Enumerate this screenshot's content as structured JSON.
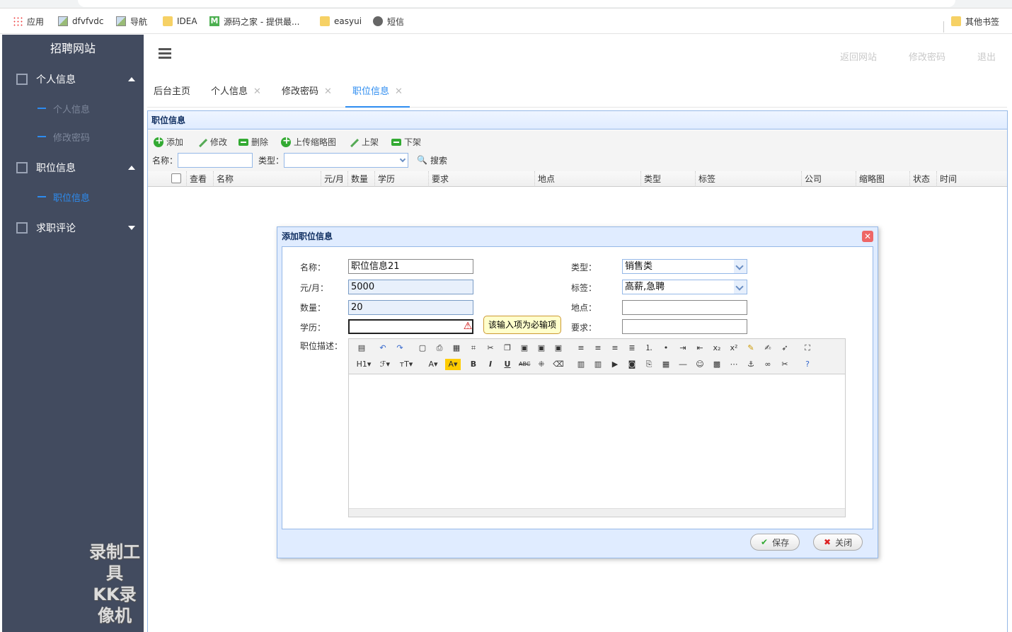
{
  "bookmarks": [
    {
      "label": "应用",
      "icon": "apps-icon"
    },
    {
      "label": "dfvfvdc",
      "icon": "image-icon"
    },
    {
      "label": "导航",
      "icon": "image-icon"
    },
    {
      "label": "IDEA",
      "icon": "folder-icon"
    },
    {
      "label": "源码之家 - 提供最...",
      "icon": "m-logo-icon"
    },
    {
      "label": "easyui",
      "icon": "folder-icon"
    },
    {
      "label": "短信",
      "icon": "globe-icon"
    },
    {
      "label": "其他书签",
      "icon": "folder-icon"
    }
  ],
  "sidebar": {
    "title": "招聘网站",
    "groups": [
      {
        "label": "个人信息",
        "expanded": true,
        "items": [
          "个人信息",
          "修改密码"
        ]
      },
      {
        "label": "职位信息",
        "expanded": true,
        "items": [
          "职位信息"
        ]
      },
      {
        "label": "求职评论",
        "expanded": false,
        "items": []
      }
    ]
  },
  "watermark": {
    "line1": "录制工具",
    "line2": "KK录像机"
  },
  "topnav": {
    "back_site": "返回网站",
    "change_pwd": "修改密码",
    "logout": "退出"
  },
  "tabs": [
    {
      "label": "后台主页",
      "closable": false
    },
    {
      "label": "个人信息",
      "closable": true
    },
    {
      "label": "修改密码",
      "closable": true
    },
    {
      "label": "职位信息",
      "closable": true,
      "active": true
    }
  ],
  "panel": {
    "title": "职位信息",
    "toolbar": {
      "add": "添加",
      "edit": "修改",
      "delete": "删除",
      "upload": "上传缩略图",
      "on_shelf": "上架",
      "off_shelf": "下架"
    },
    "search": {
      "name_label": "名称：",
      "type_label": "类型：",
      "search_btn": "搜索"
    },
    "columns": [
      "查看",
      "名称",
      "元/月",
      "数量",
      "学历",
      "要求",
      "地点",
      "类型",
      "标签",
      "公司",
      "缩略图",
      "状态",
      "时间"
    ]
  },
  "dialog": {
    "title": "添加职位信息",
    "labels": {
      "name": "名称：",
      "salary": "元/月：",
      "count": "数量：",
      "education": "学历：",
      "desc": "职位描述：",
      "type": "类型：",
      "tags": "标签：",
      "location": "地点：",
      "requirement": "要求："
    },
    "values": {
      "name": "职位信息21",
      "salary": "5000",
      "count": "20",
      "education": "",
      "type": "销售类",
      "tags": "高薪,急聘",
      "location": "",
      "requirement": ""
    },
    "validation_tip": "该输入项为必输项",
    "save": "保存",
    "close": "关闭"
  },
  "colors": {
    "sidebar_bg": "#424b5f",
    "accent": "#2d8cf0",
    "panel_border": "#95b8e7"
  }
}
